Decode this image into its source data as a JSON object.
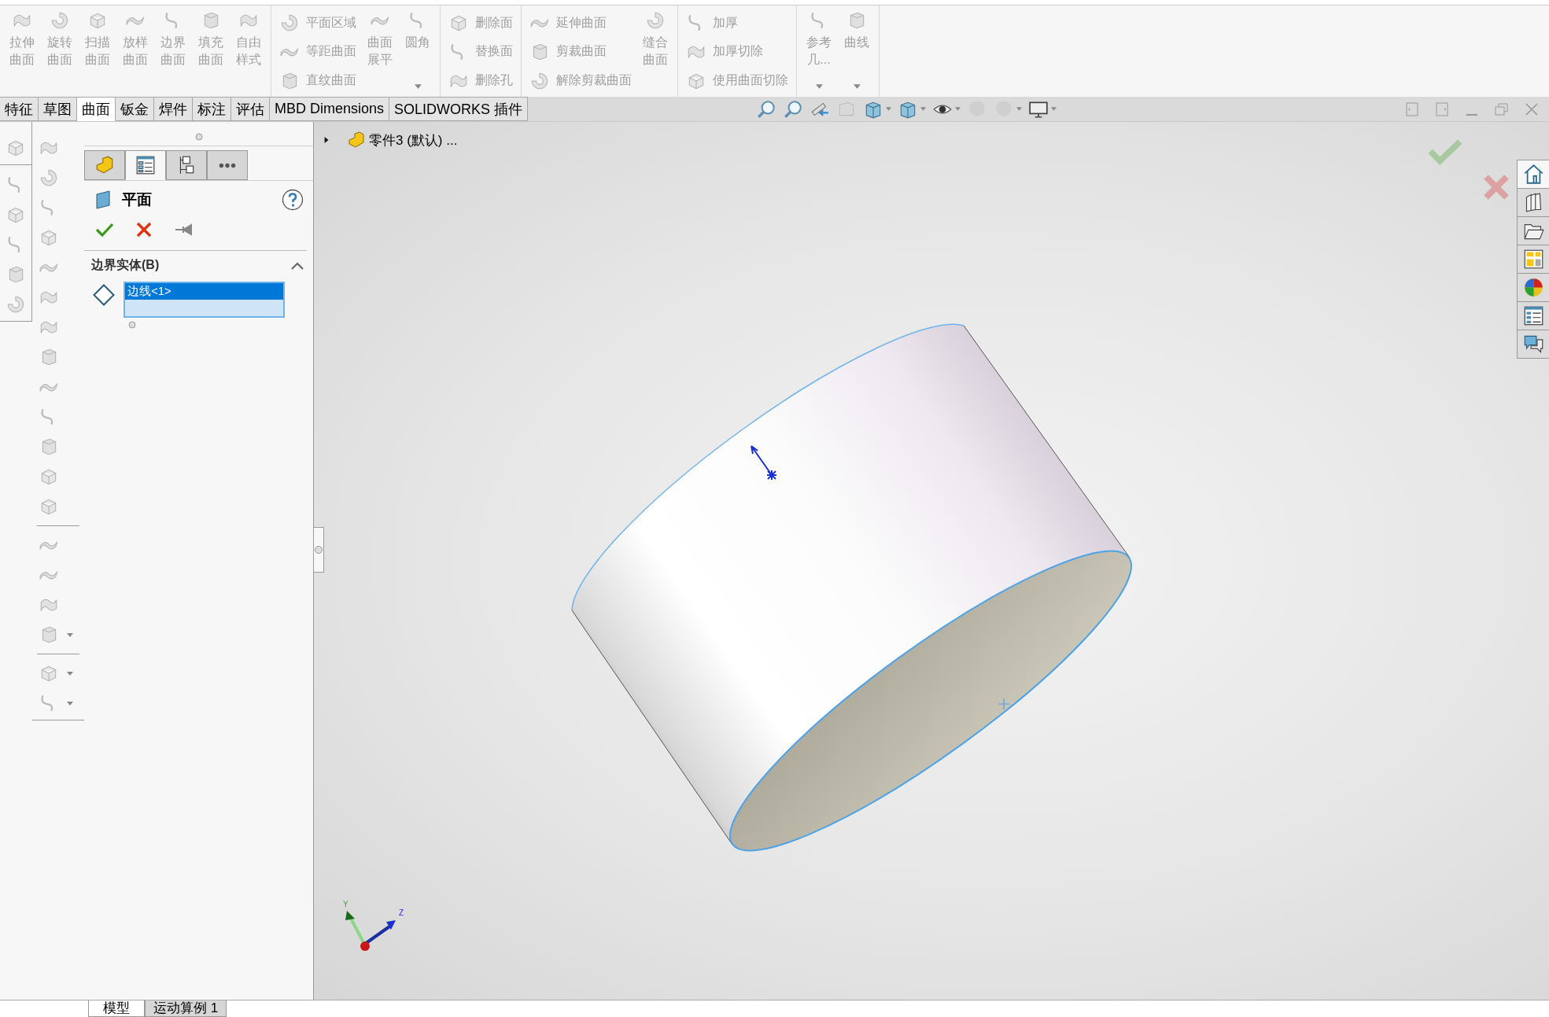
{
  "ribbon": {
    "groups": [
      {
        "columns": [
          {
            "kind": "large",
            "label": "拉伸曲面",
            "dropdown": false
          },
          {
            "kind": "large",
            "label": "旋转曲面",
            "dropdown": false
          },
          {
            "kind": "large",
            "label": "扫描曲面",
            "dropdown": false
          },
          {
            "kind": "large",
            "label": "放样曲面",
            "dropdown": false
          },
          {
            "kind": "large",
            "label": "边界曲面",
            "dropdown": false
          },
          {
            "kind": "large",
            "label": "填充曲面",
            "dropdown": false
          },
          {
            "kind": "large",
            "label": "自由样式",
            "dropdown": false
          }
        ]
      },
      {
        "columns": [
          {
            "kind": "stack",
            "items": [
              "平面区域",
              "等距曲面",
              "直纹曲面"
            ]
          },
          {
            "kind": "large",
            "label": "曲面展平",
            "dropdown": false
          },
          {
            "kind": "large",
            "label": "圆角",
            "dropdown": true
          }
        ]
      },
      {
        "columns": [
          {
            "kind": "stack",
            "items": [
              "删除面",
              "替换面",
              "删除孔"
            ]
          }
        ]
      },
      {
        "columns": [
          {
            "kind": "stack",
            "items": [
              "延伸曲面",
              "剪裁曲面",
              "解除剪裁曲面"
            ]
          },
          {
            "kind": "large",
            "label": "缝合曲面",
            "dropdown": false
          }
        ]
      },
      {
        "columns": [
          {
            "kind": "stack",
            "items": [
              "加厚",
              "加厚切除",
              "使用曲面切除"
            ]
          }
        ]
      },
      {
        "columns": [
          {
            "kind": "large",
            "label": "参考几...",
            "dropdown": true
          },
          {
            "kind": "large",
            "label": "曲线",
            "dropdown": true
          }
        ]
      }
    ]
  },
  "tabs": [
    {
      "label": "特征",
      "selected": false
    },
    {
      "label": "草图",
      "selected": false
    },
    {
      "label": "曲面",
      "selected": true
    },
    {
      "label": "钣金",
      "selected": false
    },
    {
      "label": "焊件",
      "selected": false
    },
    {
      "label": "标注",
      "selected": false
    },
    {
      "label": "评估",
      "selected": false
    },
    {
      "label": "MBD Dimensions",
      "selected": false
    },
    {
      "label": "SOLIDWORKS 插件",
      "selected": false
    }
  ],
  "property_manager": {
    "tabs": [
      {
        "kind": "part",
        "selected": false
      },
      {
        "kind": "properties",
        "selected": true
      },
      {
        "kind": "configurations",
        "selected": false
      },
      {
        "kind": "more",
        "selected": false
      }
    ],
    "title": "平面",
    "section": {
      "title": "边界实体(B)",
      "expanded": true,
      "items": [
        {
          "label": "边线<1>",
          "selected": true
        }
      ]
    }
  },
  "feature_tree": {
    "root": "零件3 (默认) ...",
    "expanded": false
  },
  "triad": {
    "axes": [
      "Y",
      "Z"
    ]
  },
  "task_pane": [
    {
      "kind": "home",
      "selected": true
    },
    {
      "kind": "books",
      "selected": false
    },
    {
      "kind": "folder",
      "selected": false
    },
    {
      "kind": "layout",
      "selected": false
    },
    {
      "kind": "ball",
      "selected": false
    },
    {
      "kind": "list",
      "selected": false
    },
    {
      "kind": "chat",
      "selected": false
    }
  ],
  "bottom_tabs": [
    {
      "label": "模型",
      "selected": true
    },
    {
      "label": "运动算例 1",
      "selected": false
    }
  ]
}
